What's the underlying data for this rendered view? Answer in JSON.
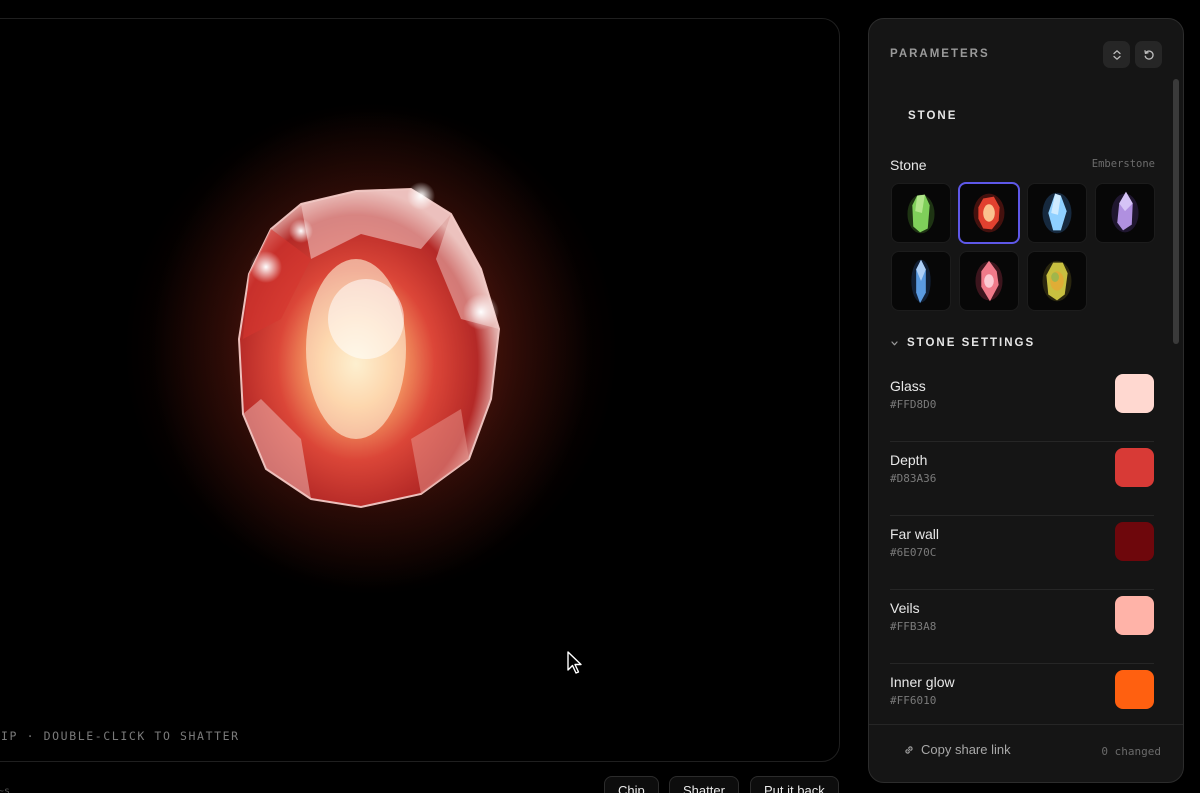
{
  "viewport": {
    "hint": "IP · DOUBLE-CLICK TO SHATTER",
    "gem_color": "#D83A36"
  },
  "bottom_bar": {
    "left_text": "~s",
    "buttons": [
      "Chip",
      "Shatter",
      "Put it back"
    ]
  },
  "panel": {
    "title": "PARAMETERS",
    "tab": "STONE",
    "stone_label": "Stone",
    "stone_value": "Emberstone",
    "stones": [
      {
        "name": "green-crystal",
        "color": "#7fcf5a"
      },
      {
        "name": "emberstone",
        "color": "#e2412f"
      },
      {
        "name": "ice-crystal",
        "color": "#8fd0ff"
      },
      {
        "name": "amethyst",
        "color": "#b090e0"
      },
      {
        "name": "sapphire-shard",
        "color": "#5a9ae0"
      },
      {
        "name": "rose-quartz",
        "color": "#f07a8a"
      },
      {
        "name": "opal",
        "color": "#c8c040"
      }
    ],
    "selected_stone": 1,
    "section_title": "STONE SETTINGS",
    "colors": [
      {
        "name": "Glass",
        "hex": "#FFD8D0"
      },
      {
        "name": "Depth",
        "hex": "#D83A36"
      },
      {
        "name": "Far wall",
        "hex": "#6E070C"
      },
      {
        "name": "Veils",
        "hex": "#FFB3A8"
      },
      {
        "name": "Inner glow",
        "hex": "#FF6010"
      }
    ],
    "footer": {
      "share_label": "Copy share link",
      "changed": "0 changed"
    }
  }
}
